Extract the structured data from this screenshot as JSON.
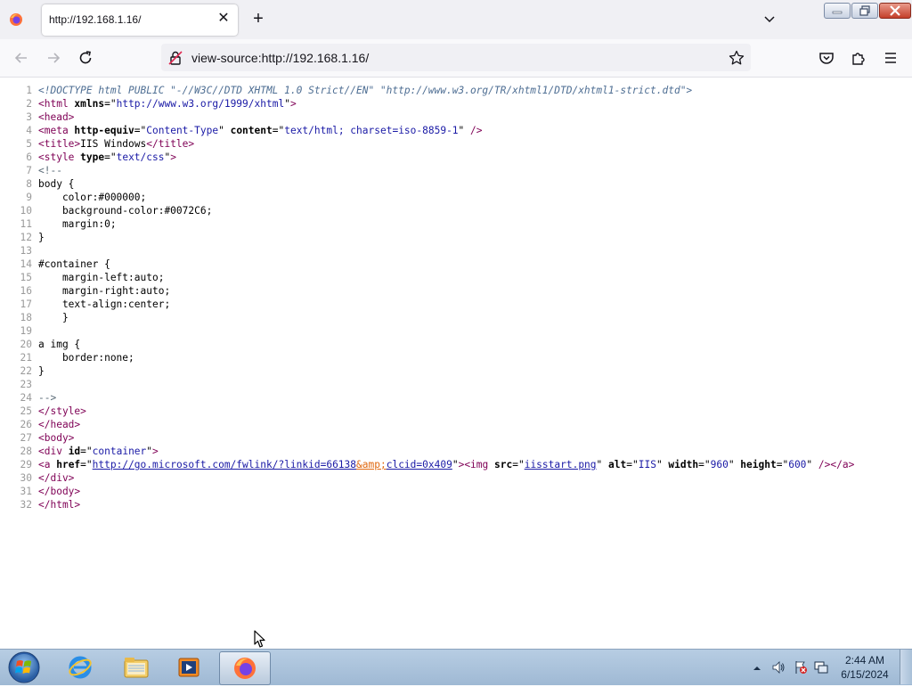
{
  "browser": {
    "tab": {
      "title": "http://192.168.1.16/",
      "icon": "firefox-icon"
    },
    "new_tab_label": "+",
    "close_tab_label": "✕",
    "url": "view-source:http://192.168.1.16/"
  },
  "source_view": {
    "line_numbers": [
      "1",
      "2",
      "3",
      "4",
      "5",
      "6",
      "7",
      "8",
      "9",
      "10",
      "11",
      "12",
      "13",
      "14",
      "15",
      "16",
      "17",
      "18",
      "19",
      "20",
      "21",
      "22",
      "23",
      "24",
      "25",
      "26",
      "27",
      "28",
      "29",
      "30",
      "31",
      "32"
    ],
    "lines": [
      [
        {
          "t": "doctype",
          "v": "<!DOCTYPE html PUBLIC \"-//W3C//DTD XHTML 1.0 Strict//EN\" \"http://www.w3.org/TR/xhtml1/DTD/xhtml1-strict.dtd\">"
        }
      ],
      [
        {
          "t": "tag",
          "v": "<html "
        },
        {
          "t": "attr",
          "v": "xmlns"
        },
        {
          "t": "plain",
          "v": "=\""
        },
        {
          "t": "val",
          "v": "http://www.w3.org/1999/xhtml"
        },
        {
          "t": "plain",
          "v": "\""
        },
        {
          "t": "tag",
          "v": ">"
        }
      ],
      [
        {
          "t": "tag",
          "v": "<head>"
        }
      ],
      [
        {
          "t": "tag",
          "v": "<meta "
        },
        {
          "t": "attr",
          "v": "http-equiv"
        },
        {
          "t": "plain",
          "v": "=\""
        },
        {
          "t": "val",
          "v": "Content-Type"
        },
        {
          "t": "plain",
          "v": "\" "
        },
        {
          "t": "attr",
          "v": "content"
        },
        {
          "t": "plain",
          "v": "=\""
        },
        {
          "t": "val",
          "v": "text/html; charset=iso-8859-1"
        },
        {
          "t": "plain",
          "v": "\" "
        },
        {
          "t": "tag",
          "v": "/>"
        }
      ],
      [
        {
          "t": "tag",
          "v": "<title>"
        },
        {
          "t": "plain",
          "v": "IIS Windows"
        },
        {
          "t": "tag",
          "v": "</title>"
        }
      ],
      [
        {
          "t": "tag",
          "v": "<style "
        },
        {
          "t": "attr",
          "v": "type"
        },
        {
          "t": "plain",
          "v": "=\""
        },
        {
          "t": "val",
          "v": "text/css"
        },
        {
          "t": "plain",
          "v": "\""
        },
        {
          "t": "tag",
          "v": ">"
        }
      ],
      [
        {
          "t": "comment",
          "v": "<!--"
        }
      ],
      [
        {
          "t": "plain",
          "v": "body {"
        }
      ],
      [
        {
          "t": "plain",
          "v": "    color:#000000;"
        }
      ],
      [
        {
          "t": "plain",
          "v": "    background-color:#0072C6;"
        }
      ],
      [
        {
          "t": "plain",
          "v": "    margin:0;"
        }
      ],
      [
        {
          "t": "plain",
          "v": "}"
        }
      ],
      [
        {
          "t": "plain",
          "v": ""
        }
      ],
      [
        {
          "t": "plain",
          "v": "#container {"
        }
      ],
      [
        {
          "t": "plain",
          "v": "    margin-left:auto;"
        }
      ],
      [
        {
          "t": "plain",
          "v": "    margin-right:auto;"
        }
      ],
      [
        {
          "t": "plain",
          "v": "    text-align:center;"
        }
      ],
      [
        {
          "t": "plain",
          "v": "    }"
        }
      ],
      [
        {
          "t": "plain",
          "v": ""
        }
      ],
      [
        {
          "t": "plain",
          "v": "a img {"
        }
      ],
      [
        {
          "t": "plain",
          "v": "    border:none;"
        }
      ],
      [
        {
          "t": "plain",
          "v": "}"
        }
      ],
      [
        {
          "t": "plain",
          "v": ""
        }
      ],
      [
        {
          "t": "comment",
          "v": "-->"
        }
      ],
      [
        {
          "t": "tag",
          "v": "</style>"
        }
      ],
      [
        {
          "t": "tag",
          "v": "</head>"
        }
      ],
      [
        {
          "t": "tag",
          "v": "<body>"
        }
      ],
      [
        {
          "t": "tag",
          "v": "<div "
        },
        {
          "t": "attr",
          "v": "id"
        },
        {
          "t": "plain",
          "v": "=\""
        },
        {
          "t": "val",
          "v": "container"
        },
        {
          "t": "plain",
          "v": "\""
        },
        {
          "t": "tag",
          "v": ">"
        }
      ],
      [
        {
          "t": "tag",
          "v": "<a "
        },
        {
          "t": "attr",
          "v": "href"
        },
        {
          "t": "plain",
          "v": "=\""
        },
        {
          "t": "link",
          "v": "http://go.microsoft.com/fwlink/?linkid=66138"
        },
        {
          "t": "entity",
          "v": "&amp;"
        },
        {
          "t": "link",
          "v": "clcid=0x409"
        },
        {
          "t": "plain",
          "v": "\""
        },
        {
          "t": "tag",
          "v": ">"
        },
        {
          "t": "tag",
          "v": "<img "
        },
        {
          "t": "attr",
          "v": "src"
        },
        {
          "t": "plain",
          "v": "=\""
        },
        {
          "t": "link",
          "v": "iisstart.png"
        },
        {
          "t": "plain",
          "v": "\" "
        },
        {
          "t": "attr",
          "v": "alt"
        },
        {
          "t": "plain",
          "v": "=\""
        },
        {
          "t": "val",
          "v": "IIS"
        },
        {
          "t": "plain",
          "v": "\" "
        },
        {
          "t": "attr",
          "v": "width"
        },
        {
          "t": "plain",
          "v": "=\""
        },
        {
          "t": "val",
          "v": "960"
        },
        {
          "t": "plain",
          "v": "\" "
        },
        {
          "t": "attr",
          "v": "height"
        },
        {
          "t": "plain",
          "v": "=\""
        },
        {
          "t": "val",
          "v": "600"
        },
        {
          "t": "plain",
          "v": "\" "
        },
        {
          "t": "tag",
          "v": "/>"
        },
        {
          "t": "tag",
          "v": "</a>"
        }
      ],
      [
        {
          "t": "tag",
          "v": "</div>"
        }
      ],
      [
        {
          "t": "tag",
          "v": "</body>"
        }
      ],
      [
        {
          "t": "tag",
          "v": "</html>"
        }
      ]
    ]
  },
  "taskbar": {
    "apps": [
      "internet-explorer-icon",
      "windows-explorer-icon",
      "media-player-icon",
      "firefox-icon"
    ],
    "active_app": "firefox-icon"
  },
  "clock": {
    "time": "2:44 AM",
    "date": "6/15/2024"
  },
  "colors": {
    "tag": "#7f0055",
    "value": "#1a1aa6",
    "doctype": "#4e6e93",
    "entity": "#e0680f",
    "line_number": "#9a9a9a"
  }
}
